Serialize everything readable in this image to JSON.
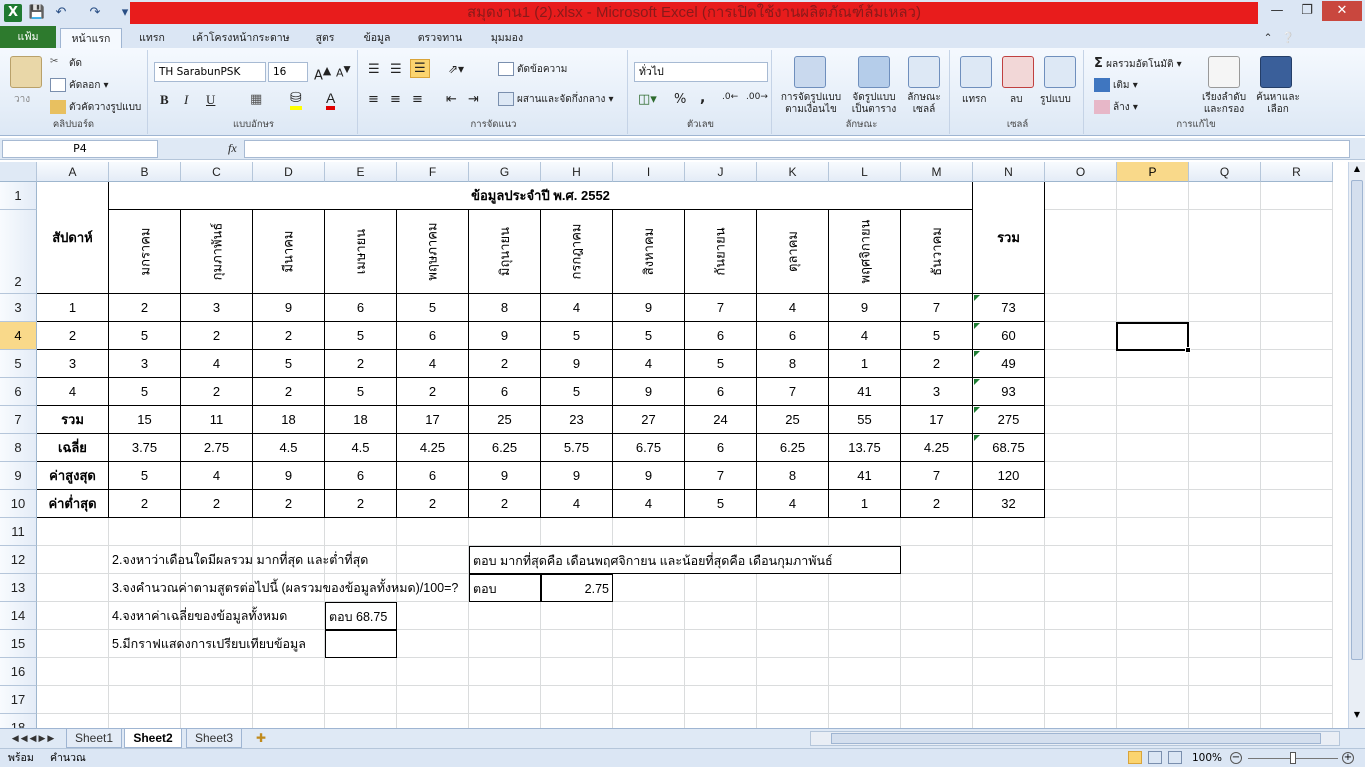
{
  "window": {
    "title": "สมุดงาน1 (2).xlsx - Microsoft Excel (การเปิดใช้งานผลิตภัณฑ์ล้มเหลว)"
  },
  "tabs": {
    "file": "แฟ้ม",
    "home": "หน้าแรก",
    "insert": "แทรก",
    "layout": "เค้าโครงหน้ากระดาษ",
    "formulas": "สูตร",
    "data": "ข้อมูล",
    "review": "ตรวจทาน",
    "view": "มุมมอง"
  },
  "ribbon": {
    "clipboard": {
      "label": "คลิปบอร์ด",
      "paste": "วาง",
      "cut": "ตัด",
      "copy": "คัดลอก",
      "format_painter": "ตัวคัดวางรูปแบบ"
    },
    "font": {
      "label": "แบบอักษร",
      "name": "TH SarabunPSK",
      "size": "16",
      "bold": "B",
      "italic": "I",
      "underline": "U"
    },
    "alignment": {
      "label": "การจัดแนว",
      "wrap": "ตัดข้อความ",
      "merge": "ผสานและจัดกึ่งกลาง"
    },
    "number": {
      "label": "ตัวเลข",
      "format": "ทั่วไป",
      "percent": "%",
      "comma": ","
    },
    "styles": {
      "label": "ลักษณะ",
      "conditional": "การจัดรูปแบบ ตามเงื่อนไข",
      "as_table": "จัดรูปแบบ เป็นตาราง",
      "cell_styles": "ลักษณะ เซลล์"
    },
    "cells": {
      "label": "เซลล์",
      "insert": "แทรก",
      "delete": "ลบ",
      "format": "รูปแบบ"
    },
    "editing": {
      "label": "การแก้ไข",
      "autosum": "ผลรวมอัตโนมัติ",
      "fill": "เติม",
      "clear": "ล้าง",
      "sort": "เรียงลำดับ และกรอง",
      "find": "ค้นหาและ เลือก"
    }
  },
  "formula_bar": {
    "name_box": "P4",
    "fx": "fx",
    "formula": ""
  },
  "columns": [
    "A",
    "B",
    "C",
    "D",
    "E",
    "F",
    "G",
    "H",
    "I",
    "J",
    "K",
    "L",
    "M",
    "N",
    "O",
    "P",
    "Q",
    "R"
  ],
  "rows": [
    "1",
    "2",
    "3",
    "4",
    "5",
    "6",
    "7",
    "8",
    "9",
    "10",
    "11",
    "12",
    "13",
    "14",
    "15",
    "16",
    "17",
    "18"
  ],
  "table": {
    "title": "ข้อมูลประจำปี พ.ศ. 2552",
    "week_header": "สัปดาห์",
    "total_header": "รวม",
    "months": [
      "มกราคม",
      "กุมภาพันธ์",
      "มีนาคม",
      "เมษายน",
      "พฤษภาคม",
      "มิถุนายน",
      "กรกฎาคม",
      "สิงหาคม",
      "กันยายน",
      "ตุลาคม",
      "พฤศจิกายน",
      "ธันวาคม"
    ],
    "data_rows": [
      {
        "label": "1",
        "values": [
          "2",
          "3",
          "9",
          "6",
          "5",
          "8",
          "4",
          "9",
          "7",
          "4",
          "9",
          "7"
        ],
        "total": "73"
      },
      {
        "label": "2",
        "values": [
          "5",
          "2",
          "2",
          "5",
          "6",
          "9",
          "5",
          "5",
          "6",
          "6",
          "4",
          "5"
        ],
        "total": "60"
      },
      {
        "label": "3",
        "values": [
          "3",
          "4",
          "5",
          "2",
          "4",
          "2",
          "9",
          "4",
          "5",
          "8",
          "1",
          "2"
        ],
        "total": "49"
      },
      {
        "label": "4",
        "values": [
          "5",
          "2",
          "2",
          "5",
          "2",
          "6",
          "5",
          "9",
          "6",
          "7",
          "41",
          "3"
        ],
        "total": "93"
      },
      {
        "label": "รวม",
        "values": [
          "15",
          "11",
          "18",
          "18",
          "17",
          "25",
          "23",
          "27",
          "24",
          "25",
          "55",
          "17"
        ],
        "total": "275"
      },
      {
        "label": "เฉลี่ย",
        "values": [
          "3.75",
          "2.75",
          "4.5",
          "4.5",
          "4.25",
          "6.25",
          "5.75",
          "6.75",
          "6",
          "6.25",
          "13.75",
          "4.25"
        ],
        "total": "68.75"
      },
      {
        "label": "ค่าสูงสุด",
        "values": [
          "5",
          "4",
          "9",
          "6",
          "6",
          "9",
          "9",
          "9",
          "7",
          "8",
          "41",
          "7"
        ],
        "total": "120"
      },
      {
        "label": "ค่าต่ำสุด",
        "values": [
          "2",
          "2",
          "2",
          "2",
          "2",
          "2",
          "4",
          "4",
          "5",
          "4",
          "1",
          "2"
        ],
        "total": "32"
      }
    ]
  },
  "questions": {
    "q2": "2.จงหาว่าเดือนใดมีผลรวม มากที่สุด และต่ำที่สุด",
    "a2": "ตอบ มากที่สุดคือ เดือนพฤศจิกายน และน้อยที่สุดคือ เดือนกุมภาพันธ์",
    "q3": "3.จงคำนวณค่าตามสูตรต่อไปนี้ (ผลรวมของข้อมูลทั้งหมด)/100=?",
    "a3_label": "ตอบ",
    "a3_value": "2.75",
    "q4": "4.จงหาค่าเฉลี่ยของข้อมูลทั้งหมด",
    "a4": "ตอบ 68.75",
    "q5": "5.มีกราฟแสดงการเปรียบเทียบข้อมูล"
  },
  "sheets": [
    "Sheet1",
    "Sheet2",
    "Sheet3"
  ],
  "status": {
    "ready": "พร้อม",
    "calc": "คำนวณ",
    "zoom": "100%"
  }
}
